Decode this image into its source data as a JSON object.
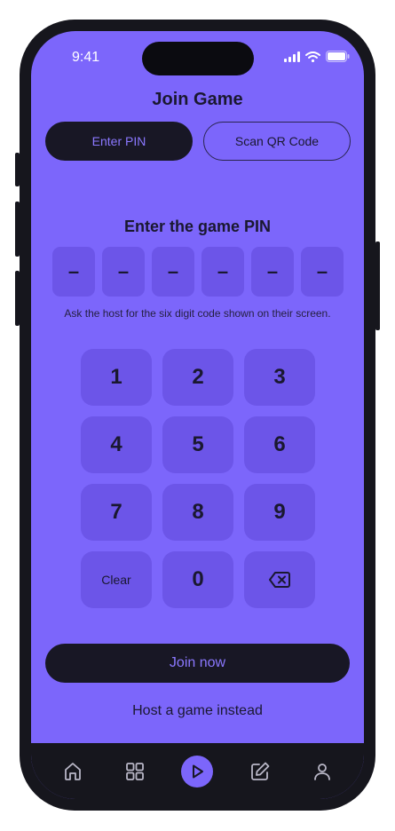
{
  "status_bar": {
    "time": "9:41",
    "icons": [
      "signal-icon",
      "wifi-icon",
      "battery-icon"
    ]
  },
  "header": {
    "title": "Join Game"
  },
  "mode_tabs": {
    "enter_pin": "Enter PIN",
    "scan_qr": "Scan QR Code",
    "selected": "Enter PIN"
  },
  "pin": {
    "title": "Enter the game PIN",
    "digits": [
      "–",
      "–",
      "–",
      "–",
      "–",
      "–"
    ],
    "hint": "Ask the host for the six digit code shown on their screen."
  },
  "keypad": {
    "keys": [
      "1",
      "2",
      "3",
      "4",
      "5",
      "6",
      "7",
      "8",
      "9",
      "Clear",
      "0"
    ],
    "backspace_icon": "backspace-icon"
  },
  "actions": {
    "join": "Join now",
    "host": "Host a game instead"
  },
  "tabbar": {
    "items": [
      "home-icon",
      "grid-icon",
      "play-icon",
      "edit-icon",
      "profile-icon"
    ],
    "active": "play-icon"
  },
  "colors": {
    "background": "#7c66fb",
    "dark": "#181725",
    "accent_text": "#8b78ff",
    "tile": "#6c55e8"
  }
}
